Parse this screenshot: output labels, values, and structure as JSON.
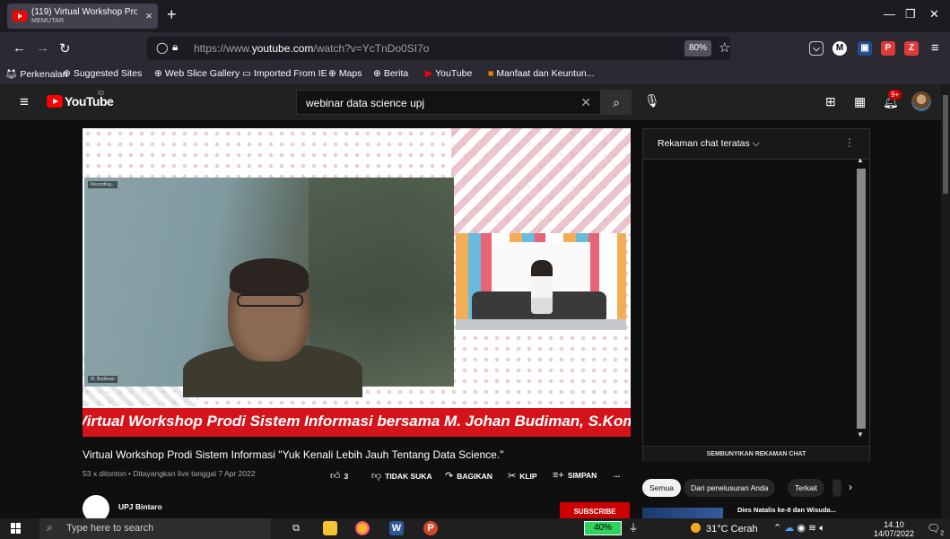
{
  "browser": {
    "tab_title": "(119) Virtual Workshop Prodi Si",
    "tab_subtitle": "MEMUTAR",
    "url_prefix": "https://www.",
    "url_domain": "youtube.com",
    "url_path": "/watch?v=YcTnDo0SI7o",
    "zoom": "80%",
    "bookmarks": [
      "Perkenalan",
      "Suggested Sites",
      "Web Slice Gallery",
      "Imported From IE",
      "Maps",
      "Berita",
      "YouTube",
      "Manfaat dan Keuntun..."
    ]
  },
  "youtube": {
    "logo_text": "YouTube",
    "region": "ID",
    "search_value": "webinar data science upj",
    "notif_count": "9+"
  },
  "video": {
    "banner_text": "Virtual Workshop Prodi Sistem Informasi bersama M. Johan Budiman, S.Kom., M.Kom",
    "cam_label": "Recording...",
    "cam_name": "M. Budiman",
    "title": "Virtual Workshop Prodi Sistem Informasi \"Yuk Kenali Lebih Jauh Tentang Data Science.\"",
    "meta": "53 x ditonton • Ditayangkan live tanggal 7 Apr 2022",
    "likes": "3",
    "dislike_label": "TIDAK SUKA",
    "share_label": "BAGIKAN",
    "clip_label": "KLIP",
    "save_label": "SIMPAN",
    "more": "...",
    "channel": "UPJ Bintaro",
    "subscribe": "SUBSCRIBE"
  },
  "chat": {
    "header": "Rekaman chat teratas",
    "hide_label": "SEMBUNYIKAN REKAMAN CHAT"
  },
  "chips": [
    "Semua",
    "Dari penelusuran Anda",
    "Terkait"
  ],
  "related_title": "Dies Natalis ke-8 dan Wisuda...",
  "taskbar": {
    "search_placeholder": "Type here to search",
    "battery": "40%",
    "weather": "31°C  Cerah",
    "time": "14.10",
    "date": "14/07/2022",
    "notif_count": "2"
  }
}
